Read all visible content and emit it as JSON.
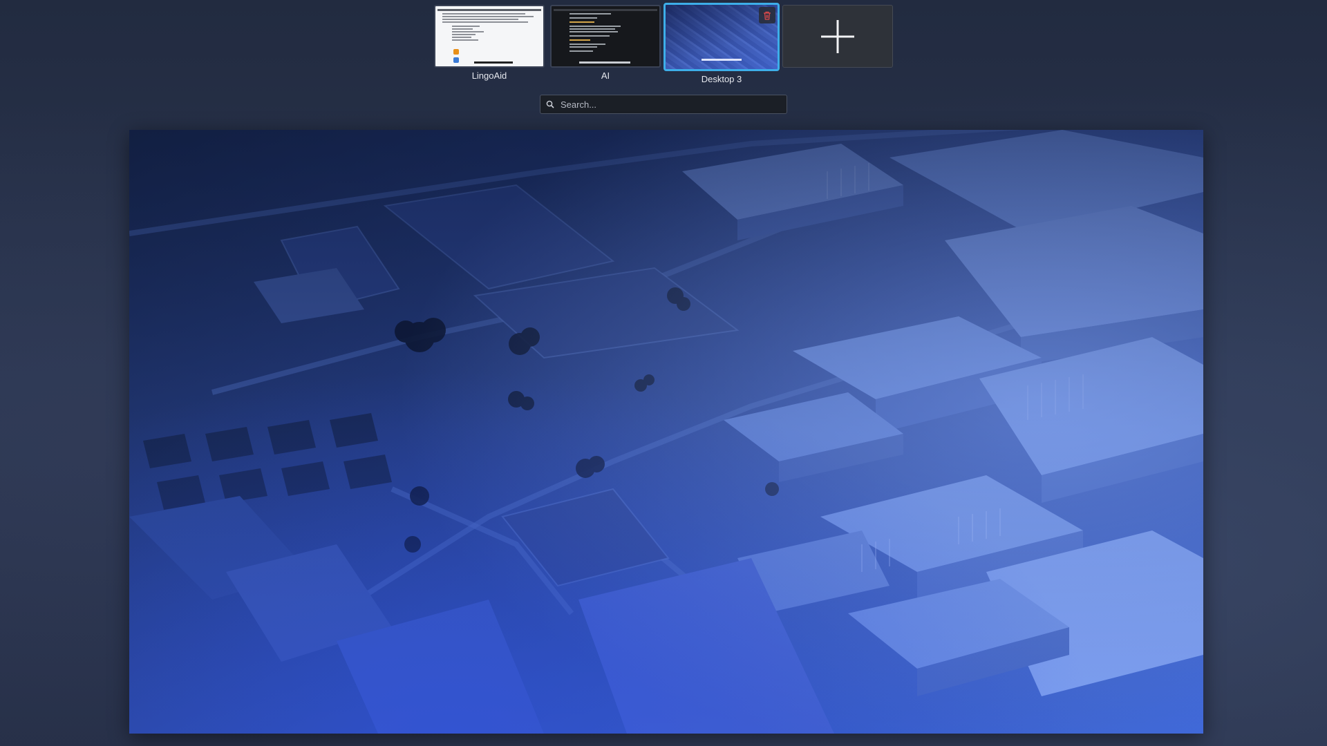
{
  "desktops": [
    {
      "label": "LingoAid",
      "thumbnail": "light-document",
      "active": false
    },
    {
      "label": "AI",
      "thumbnail": "dark-terminal",
      "active": false
    },
    {
      "label": "Desktop 3",
      "thumbnail": "wallpaper",
      "active": true
    }
  ],
  "add_desktop": {
    "icon": "plus-icon"
  },
  "remove_desktop": {
    "icon": "trash-icon",
    "color": "#e04a4a"
  },
  "search": {
    "placeholder": "Search...",
    "value": "",
    "icon": "search-icon"
  },
  "colors": {
    "accent": "#3daee9"
  }
}
